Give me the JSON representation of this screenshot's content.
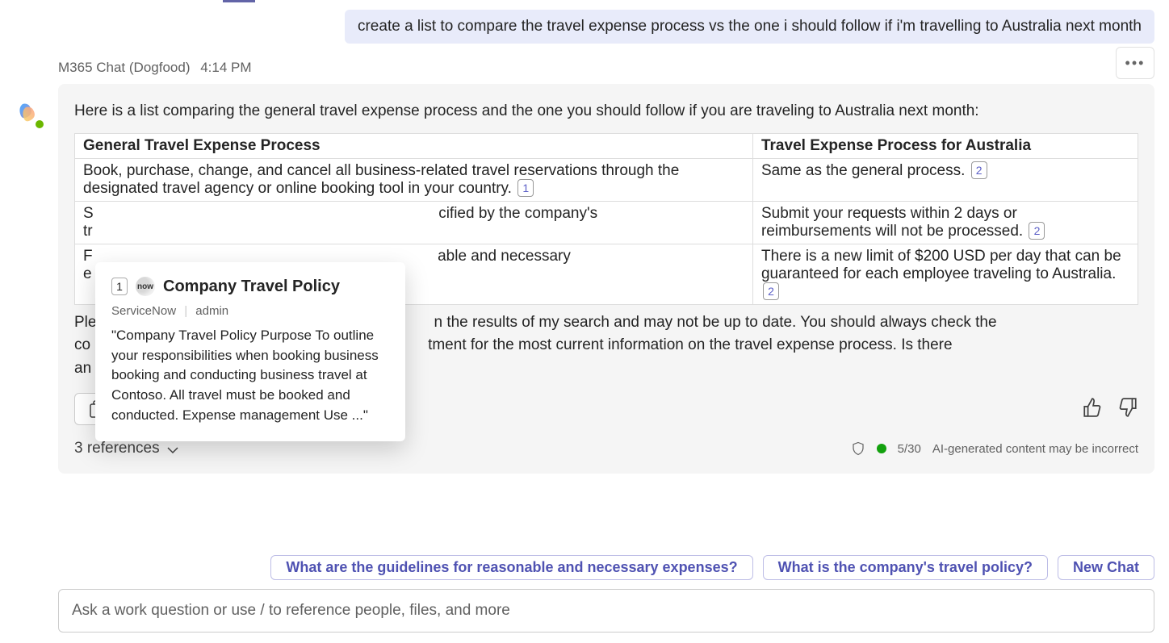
{
  "user_message": "create a list to compare the travel expense process vs the one i should follow if i'm travelling to Australia next month",
  "sender": {
    "name": "M365 Chat (Dogfood)",
    "time": "4:14 PM"
  },
  "intro": "Here is a list comparing the general travel expense process and the one you should follow if you are traveling to Australia next month:",
  "table": {
    "head_left": "General Travel Expense Process",
    "head_right": "Travel Expense Process for Australia",
    "rows": [
      {
        "left": "Book, purchase, change, and cancel all business-related travel reservations through the designated travel agency or online booking tool in your country.",
        "left_cite": "1",
        "right": "Same as the general process.",
        "right_cite": "2"
      },
      {
        "left_a": "S",
        "left_b": "cified by the company's",
        "left_c": "tr",
        "right": "Submit your requests within 2 days or reimbursements will not be processed.",
        "right_cite": "2"
      },
      {
        "left_a": "F",
        "left_b": "able and necessary",
        "left_c": "e",
        "right": "There is a new limit of $200 USD per day that can be guaranteed for each employee traveling to Australia.",
        "right_cite": "2"
      }
    ]
  },
  "outro_pre": "Ple",
  "outro_mid1": "n the results of my search and may not be up to date. You should always check the",
  "outro_line2a": "co",
  "outro_line2b": "tment for the most current information on the travel expense process. Is there",
  "outro_line3": "an",
  "copy_label": "Copy",
  "refs_label": "3 references",
  "usage": "5/30",
  "disclaimer": "AI-generated content may be incorrect",
  "suggestions": [
    "What are the guidelines for reasonable and necessary expenses?",
    "What is the company's travel policy?",
    "New Chat"
  ],
  "compose_placeholder": "Ask a work question or use / to reference people, files, and more",
  "popup": {
    "num": "1",
    "logo_text": "now",
    "title": "Company Travel Policy",
    "meta_source": "ServiceNow",
    "meta_author": "admin",
    "body": "\"Company Travel Policy Purpose To outline your responsibilities when booking business booking and conducting business travel at Contoso. All travel must be booked and conducted. Expense management Use ...\""
  }
}
